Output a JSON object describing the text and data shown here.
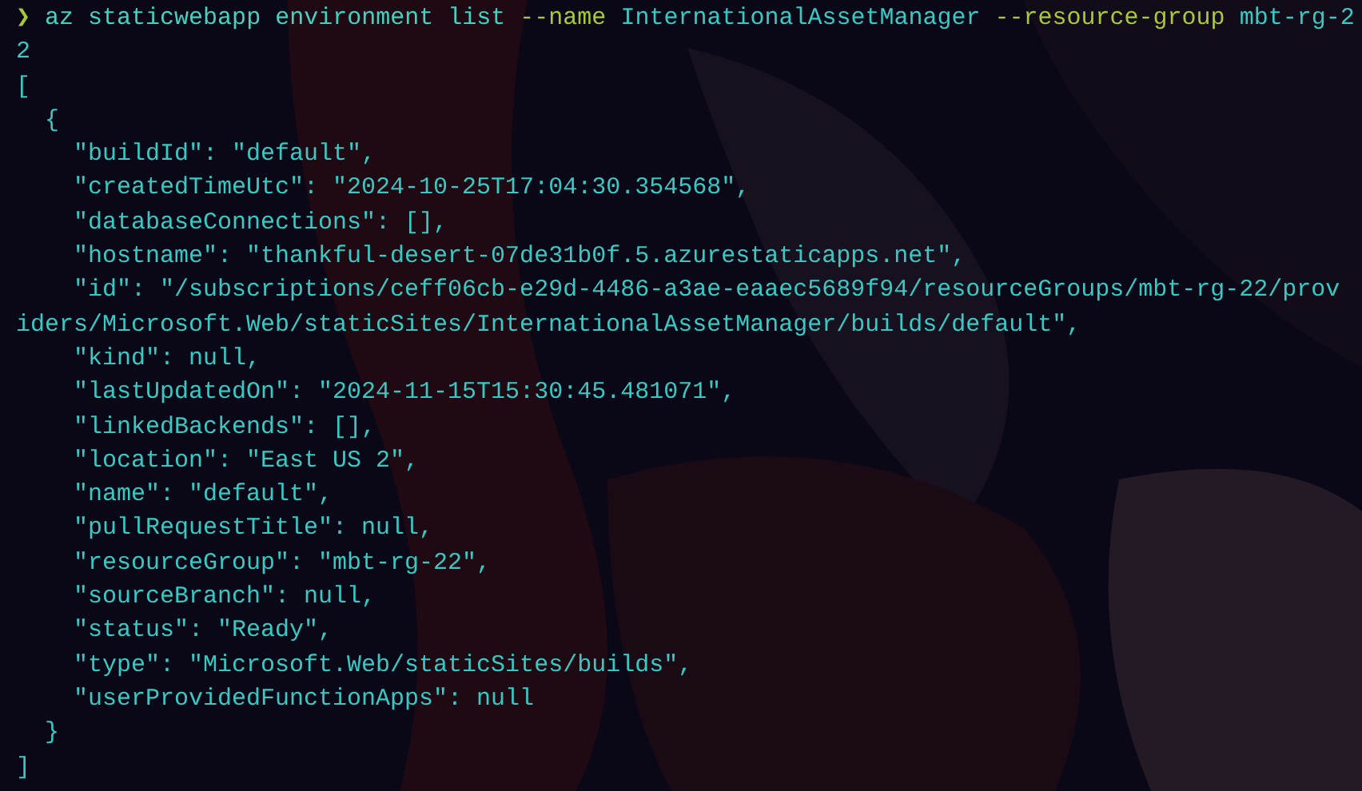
{
  "prompt": {
    "symbol": "❯",
    "tokens": [
      {
        "text": "az",
        "kind": "command"
      },
      {
        "text": "staticwebapp",
        "kind": "command"
      },
      {
        "text": "environment",
        "kind": "command"
      },
      {
        "text": "list",
        "kind": "command"
      },
      {
        "text": "--name",
        "kind": "flag"
      },
      {
        "text": "InternationalAssetManager",
        "kind": "value"
      },
      {
        "text": "--resource-group",
        "kind": "flag"
      },
      {
        "text": "mbt-rg-22",
        "kind": "value"
      }
    ]
  },
  "output_lines": [
    "[",
    "  {",
    "    \"buildId\": \"default\",",
    "    \"createdTimeUtc\": \"2024-10-25T17:04:30.354568\",",
    "    \"databaseConnections\": [],",
    "    \"hostname\": \"thankful-desert-07de31b0f.5.azurestaticapps.net\",",
    "    \"id\": \"/subscriptions/ceff06cb-e29d-4486-a3ae-eaaec5689f94/resourceGroups/mbt-rg-22/providers/Microsoft.Web/staticSites/InternationalAssetManager/builds/default\",",
    "    \"kind\": null,",
    "    \"lastUpdatedOn\": \"2024-11-15T15:30:45.481071\",",
    "    \"linkedBackends\": [],",
    "    \"location\": \"East US 2\",",
    "    \"name\": \"default\",",
    "    \"pullRequestTitle\": null,",
    "    \"resourceGroup\": \"mbt-rg-22\",",
    "    \"sourceBranch\": null,",
    "    \"status\": \"Ready\",",
    "    \"type\": \"Microsoft.Web/staticSites/builds\",",
    "    \"userProvidedFunctionApps\": null",
    "  }",
    "]"
  ]
}
